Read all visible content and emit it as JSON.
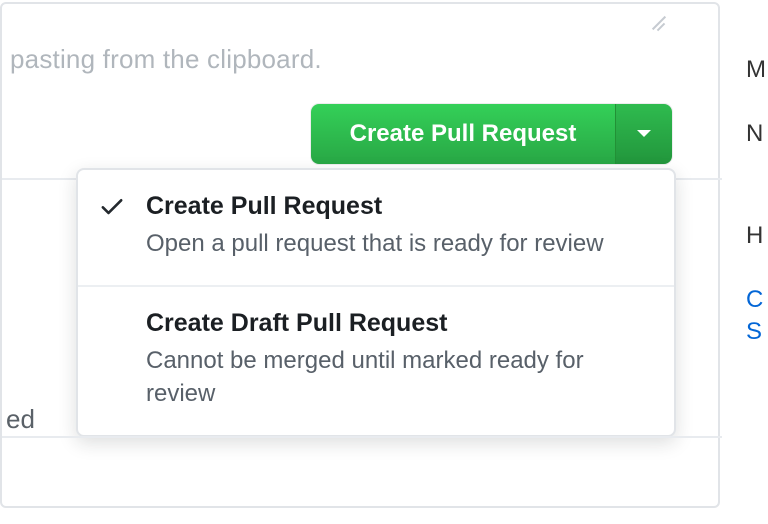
{
  "hint_text": "pasting from the clipboard.",
  "truncated_left_text": "ed",
  "button": {
    "label": "Create Pull Request"
  },
  "dropdown": {
    "items": [
      {
        "selected": true,
        "title": "Create Pull Request",
        "description": "Open a pull request that is ready for review"
      },
      {
        "selected": false,
        "title": "Create Draft Pull Request",
        "description": "Cannot be merged until marked ready for review"
      }
    ]
  },
  "side_fragments": {
    "m": "M",
    "n": "N",
    "h": "H",
    "c": "C",
    "s": "S"
  }
}
